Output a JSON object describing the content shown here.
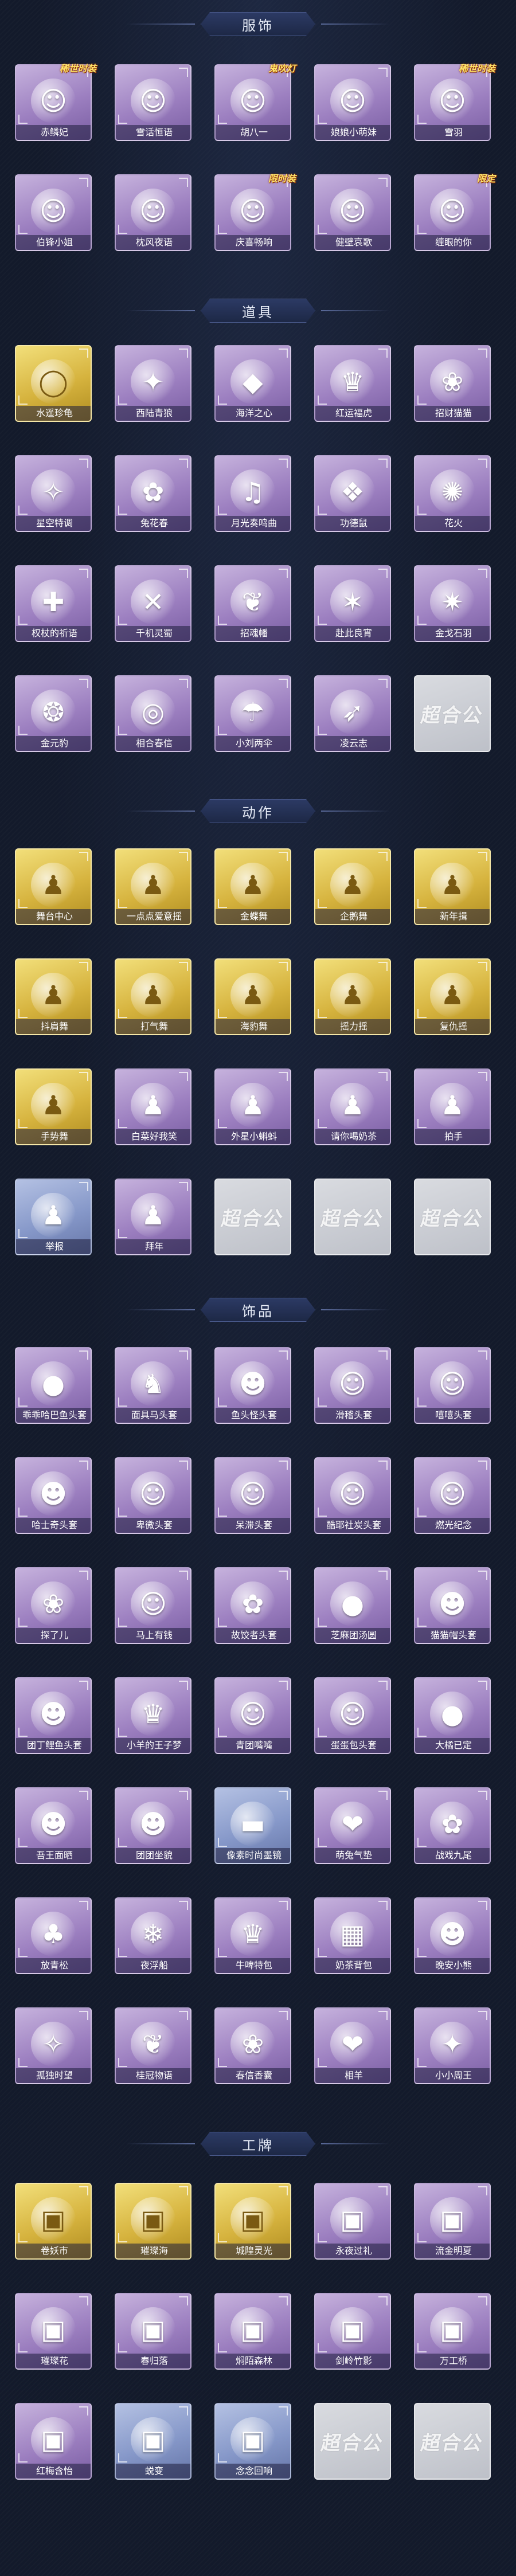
{
  "sections": [
    {
      "title": "服饰",
      "items": [
        {
          "label": "赤鳞妃",
          "icon": "☺",
          "tone": "purple",
          "badge": "稀世时装"
        },
        {
          "label": "雪话恒语",
          "icon": "☺",
          "tone": "purple",
          "badge": ""
        },
        {
          "label": "胡八一",
          "icon": "☺",
          "tone": "purple",
          "badge": "鬼吹灯"
        },
        {
          "label": "娘娘小萌妹",
          "icon": "☺",
          "tone": "purple",
          "badge": ""
        },
        {
          "label": "雪羽",
          "icon": "☺",
          "tone": "purple",
          "badge": "稀世时装"
        },
        {
          "label": "伯锋小姐",
          "icon": "☺",
          "tone": "purple",
          "badge": ""
        },
        {
          "label": "枕风夜语",
          "icon": "☺",
          "tone": "purple",
          "badge": ""
        },
        {
          "label": "庆喜畅响",
          "icon": "☺",
          "tone": "purple",
          "badge": "限时装"
        },
        {
          "label": "健壁哀歌",
          "icon": "☺",
          "tone": "purple",
          "badge": ""
        },
        {
          "label": "缠眼的你",
          "icon": "☺",
          "tone": "purple",
          "badge": "限定"
        }
      ]
    },
    {
      "title": "道具",
      "items": [
        {
          "label": "水遥珍龟",
          "icon": "◯",
          "tone": "gold",
          "badge": ""
        },
        {
          "label": "西陆青狼",
          "icon": "✦",
          "tone": "purple",
          "badge": ""
        },
        {
          "label": "海洋之心",
          "icon": "◆",
          "tone": "purple",
          "badge": ""
        },
        {
          "label": "红运福虎",
          "icon": "♛",
          "tone": "purple",
          "badge": ""
        },
        {
          "label": "招财猫猫",
          "icon": "❀",
          "tone": "purple",
          "badge": ""
        },
        {
          "label": "星空特调",
          "icon": "✧",
          "tone": "purple",
          "badge": ""
        },
        {
          "label": "兔花春",
          "icon": "✿",
          "tone": "purple",
          "badge": ""
        },
        {
          "label": "月光奏鸣曲",
          "icon": "♫",
          "tone": "purple",
          "badge": ""
        },
        {
          "label": "功德鼠",
          "icon": "❖",
          "tone": "purple",
          "badge": ""
        },
        {
          "label": "花火",
          "icon": "✺",
          "tone": "purple",
          "badge": ""
        },
        {
          "label": "权杖的祈语",
          "icon": "✚",
          "tone": "purple",
          "badge": ""
        },
        {
          "label": "千机灵蜀",
          "icon": "✕",
          "tone": "purple",
          "badge": ""
        },
        {
          "label": "招魂幡",
          "icon": "❦",
          "tone": "purple",
          "badge": ""
        },
        {
          "label": "赴此良宵",
          "icon": "✶",
          "tone": "purple",
          "badge": ""
        },
        {
          "label": "金戈石羽",
          "icon": "✷",
          "tone": "purple",
          "badge": ""
        },
        {
          "label": "金元豹",
          "icon": "❂",
          "tone": "purple",
          "badge": ""
        },
        {
          "label": "相合春信",
          "icon": "◎",
          "tone": "purple",
          "badge": ""
        },
        {
          "label": "小刘两伞",
          "icon": "☂",
          "tone": "purple",
          "badge": ""
        },
        {
          "label": "凌云志",
          "icon": "➶",
          "tone": "purple",
          "badge": ""
        },
        {
          "label": "",
          "icon": "",
          "tone": "empty",
          "badge": "",
          "placeholder": "超合公"
        }
      ]
    },
    {
      "title": "动作",
      "items": [
        {
          "label": "舞台中心",
          "icon": "♟",
          "tone": "gold",
          "badge": ""
        },
        {
          "label": "一点点爱意摇",
          "icon": "♟",
          "tone": "gold",
          "badge": ""
        },
        {
          "label": "金蝶舞",
          "icon": "♟",
          "tone": "gold",
          "badge": ""
        },
        {
          "label": "企鹅舞",
          "icon": "♟",
          "tone": "gold",
          "badge": ""
        },
        {
          "label": "新年揖",
          "icon": "♟",
          "tone": "gold",
          "badge": ""
        },
        {
          "label": "抖肩舞",
          "icon": "♟",
          "tone": "gold",
          "badge": ""
        },
        {
          "label": "打气舞",
          "icon": "♟",
          "tone": "gold",
          "badge": ""
        },
        {
          "label": "海豹舞",
          "icon": "♟",
          "tone": "gold",
          "badge": ""
        },
        {
          "label": "摇力摇",
          "icon": "♟",
          "tone": "gold",
          "badge": ""
        },
        {
          "label": "复仇摇",
          "icon": "♟",
          "tone": "gold",
          "badge": ""
        },
        {
          "label": "手势舞",
          "icon": "♟",
          "tone": "gold",
          "badge": ""
        },
        {
          "label": "白菜好我笑",
          "icon": "♟",
          "tone": "purple",
          "badge": ""
        },
        {
          "label": "外星小蝌蚪",
          "icon": "♟",
          "tone": "purple",
          "badge": ""
        },
        {
          "label": "请你喝奶茶",
          "icon": "♟",
          "tone": "purple",
          "badge": ""
        },
        {
          "label": "拍手",
          "icon": "♟",
          "tone": "purple",
          "badge": ""
        },
        {
          "label": "举报",
          "icon": "♟",
          "tone": "blue",
          "badge": ""
        },
        {
          "label": "拜年",
          "icon": "♟",
          "tone": "purple",
          "badge": ""
        },
        {
          "label": "",
          "icon": "",
          "tone": "empty",
          "badge": "",
          "placeholder": "超合公"
        },
        {
          "label": "",
          "icon": "",
          "tone": "empty",
          "badge": "",
          "placeholder": "超合公"
        },
        {
          "label": "",
          "icon": "",
          "tone": "empty",
          "badge": "",
          "placeholder": "超合公"
        }
      ]
    },
    {
      "title": "饰品",
      "items": [
        {
          "label": "乖乖哈巴鱼头套",
          "icon": "●",
          "tone": "purple",
          "badge": ""
        },
        {
          "label": "面具马头套",
          "icon": "♞",
          "tone": "purple",
          "badge": ""
        },
        {
          "label": "鱼头怪头套",
          "icon": "☻",
          "tone": "purple",
          "badge": ""
        },
        {
          "label": "滑稽头套",
          "icon": "☺",
          "tone": "purple",
          "badge": ""
        },
        {
          "label": "嘻嘻头套",
          "icon": "☺",
          "tone": "purple",
          "badge": ""
        },
        {
          "label": "哈士奇头套",
          "icon": "☻",
          "tone": "purple",
          "badge": ""
        },
        {
          "label": "卑微头套",
          "icon": "☺",
          "tone": "purple",
          "badge": ""
        },
        {
          "label": "呆滞头套",
          "icon": "☺",
          "tone": "purple",
          "badge": ""
        },
        {
          "label": "酷耶社炭头套",
          "icon": "☺",
          "tone": "purple",
          "badge": ""
        },
        {
          "label": "燃光纪念",
          "icon": "☺",
          "tone": "purple",
          "badge": ""
        },
        {
          "label": "探了儿",
          "icon": "❀",
          "tone": "purple",
          "badge": ""
        },
        {
          "label": "马上有钱",
          "icon": "☺",
          "tone": "purple",
          "badge": ""
        },
        {
          "label": "故饺者头套",
          "icon": "✿",
          "tone": "purple",
          "badge": ""
        },
        {
          "label": "芝麻团汤圆",
          "icon": "●",
          "tone": "purple",
          "badge": ""
        },
        {
          "label": "猫猫帽头套",
          "icon": "☻",
          "tone": "purple",
          "badge": ""
        },
        {
          "label": "团丁鲤鱼头套",
          "icon": "☻",
          "tone": "purple",
          "badge": ""
        },
        {
          "label": "小羊的王子梦",
          "icon": "♛",
          "tone": "purple",
          "badge": ""
        },
        {
          "label": "青团嘴嘴",
          "icon": "☺",
          "tone": "purple",
          "badge": ""
        },
        {
          "label": "蛋蛋包头套",
          "icon": "☺",
          "tone": "purple",
          "badge": ""
        },
        {
          "label": "大橘已定",
          "icon": "●",
          "tone": "purple",
          "badge": ""
        },
        {
          "label": "吾王面晒",
          "icon": "☻",
          "tone": "purple",
          "badge": ""
        },
        {
          "label": "团团坐貌",
          "icon": "☻",
          "tone": "purple",
          "badge": ""
        },
        {
          "label": "像素时尚墨镜",
          "icon": "▬",
          "tone": "blue",
          "badge": ""
        },
        {
          "label": "萌兔气垫",
          "icon": "❤",
          "tone": "purple",
          "badge": ""
        },
        {
          "label": "战戏九尾",
          "icon": "✿",
          "tone": "purple",
          "badge": ""
        },
        {
          "label": "放青松",
          "icon": "♣",
          "tone": "purple",
          "badge": ""
        },
        {
          "label": "夜浮船",
          "icon": "❄",
          "tone": "purple",
          "badge": ""
        },
        {
          "label": "牛啤特包",
          "icon": "♛",
          "tone": "purple",
          "badge": ""
        },
        {
          "label": "奶茶背包",
          "icon": "▦",
          "tone": "purple",
          "badge": ""
        },
        {
          "label": "晚安小熊",
          "icon": "☻",
          "tone": "purple",
          "badge": ""
        },
        {
          "label": "孤独时望",
          "icon": "✧",
          "tone": "purple",
          "badge": ""
        },
        {
          "label": "桂冠物语",
          "icon": "❦",
          "tone": "purple",
          "badge": ""
        },
        {
          "label": "春信香囊",
          "icon": "❀",
          "tone": "purple",
          "badge": ""
        },
        {
          "label": "相羊",
          "icon": "❤",
          "tone": "purple",
          "badge": ""
        },
        {
          "label": "小小周王",
          "icon": "✦",
          "tone": "purple",
          "badge": ""
        }
      ]
    },
    {
      "title": "工牌",
      "items": [
        {
          "label": "卷妖市",
          "icon": "▣",
          "tone": "gold",
          "badge": ""
        },
        {
          "label": "璀璨海",
          "icon": "▣",
          "tone": "gold",
          "badge": ""
        },
        {
          "label": "城隍灵光",
          "icon": "▣",
          "tone": "gold",
          "badge": ""
        },
        {
          "label": "永夜过礼",
          "icon": "▣",
          "tone": "purple",
          "badge": ""
        },
        {
          "label": "流金明夏",
          "icon": "▣",
          "tone": "purple",
          "badge": ""
        },
        {
          "label": "璀璨花",
          "icon": "▣",
          "tone": "purple",
          "badge": ""
        },
        {
          "label": "春归落",
          "icon": "▣",
          "tone": "purple",
          "badge": ""
        },
        {
          "label": "焖陌森林",
          "icon": "▣",
          "tone": "purple",
          "badge": ""
        },
        {
          "label": "剑岭竹影",
          "icon": "▣",
          "tone": "purple",
          "badge": ""
        },
        {
          "label": "万工桥",
          "icon": "▣",
          "tone": "purple",
          "badge": ""
        },
        {
          "label": "红梅含怡",
          "icon": "▣",
          "tone": "purple",
          "badge": ""
        },
        {
          "label": "蜕变",
          "icon": "▣",
          "tone": "blue",
          "badge": ""
        },
        {
          "label": "念念回响",
          "icon": "▣",
          "tone": "blue",
          "badge": ""
        },
        {
          "label": "",
          "icon": "",
          "tone": "empty",
          "badge": "",
          "placeholder": "超合公"
        },
        {
          "label": "",
          "icon": "",
          "tone": "empty",
          "badge": "",
          "placeholder": "超合公"
        }
      ]
    }
  ]
}
